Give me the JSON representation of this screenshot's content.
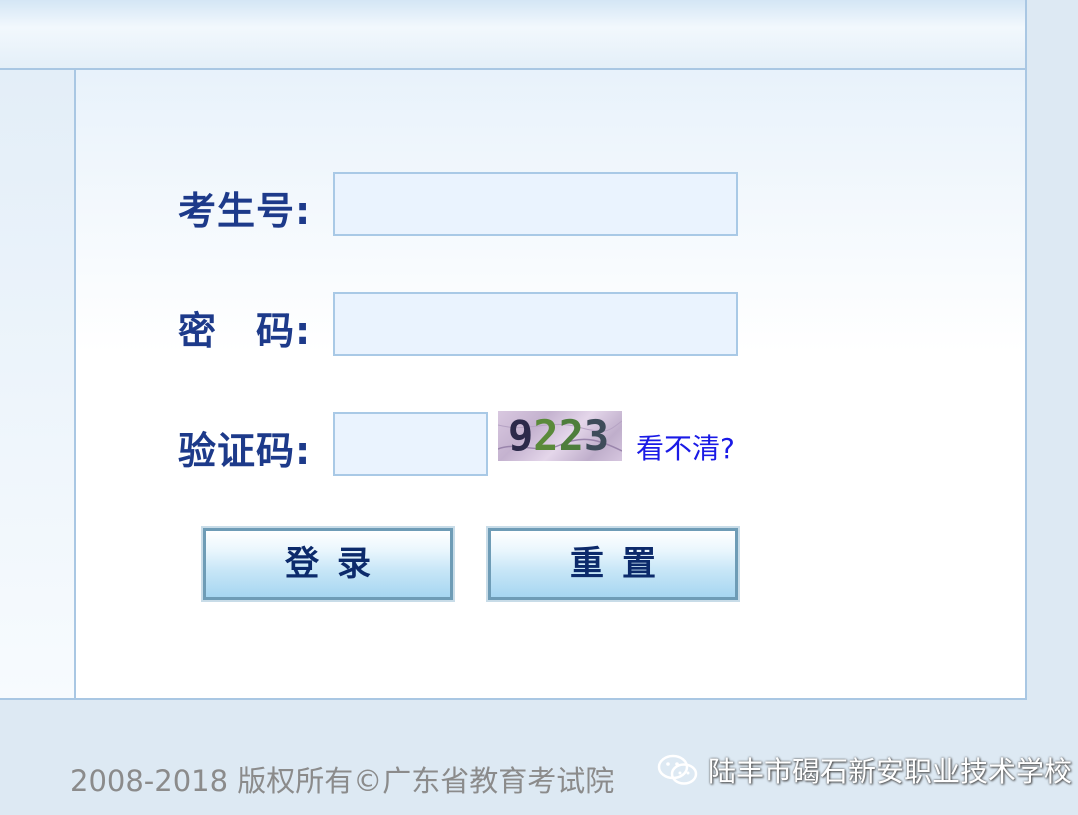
{
  "form": {
    "exam_number_label": "考生号:",
    "exam_number_value": "",
    "password_label": "密　码:",
    "password_value": "",
    "captcha_label": "验证码:",
    "captcha_value": "",
    "captcha_image_text": "9223",
    "refresh_captcha_link": "看不清?"
  },
  "buttons": {
    "login_label": "登录",
    "reset_label": "重置"
  },
  "footer": {
    "copyright": "2008-2018  版权所有©广东省教育考试院"
  },
  "watermark": {
    "text": "陆丰市碣石新安职业技术学校",
    "icon": "wechat-icon"
  },
  "colors": {
    "label": "#1d3a8a",
    "link": "#1a1ae6",
    "input_bg": "#eaf3fe",
    "input_border": "#a9c9e6",
    "page_bg": "#dde9f3"
  }
}
